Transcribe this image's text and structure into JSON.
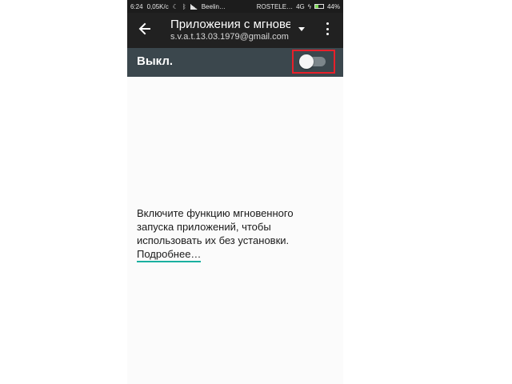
{
  "status_bar": {
    "time": "6:24",
    "speed": "0,05K/c",
    "carrier1": "Beelin…",
    "carrier2": "ROSTELE…",
    "network": "4G",
    "battery": "44%",
    "battery_level": 0.44
  },
  "app_bar": {
    "title": "Приложения с мгновенным запуском",
    "account": "s.v.a.t.13.03.1979@gmail.com"
  },
  "toggle": {
    "label": "Выкл.",
    "state": "off"
  },
  "content": {
    "description": "Включите функцию мгновенного запуска приложений, чтобы использовать их без установки.",
    "link": "Подробнее…"
  },
  "colors": {
    "app_bar": "#212121",
    "toggle_bar": "#3b474d",
    "highlight": "#e8202a",
    "link_underline": "#1ab0a0"
  },
  "icons": {
    "back": "arrow-left-icon",
    "dropdown": "caret-down-icon",
    "more": "vertical-dots-icon"
  }
}
